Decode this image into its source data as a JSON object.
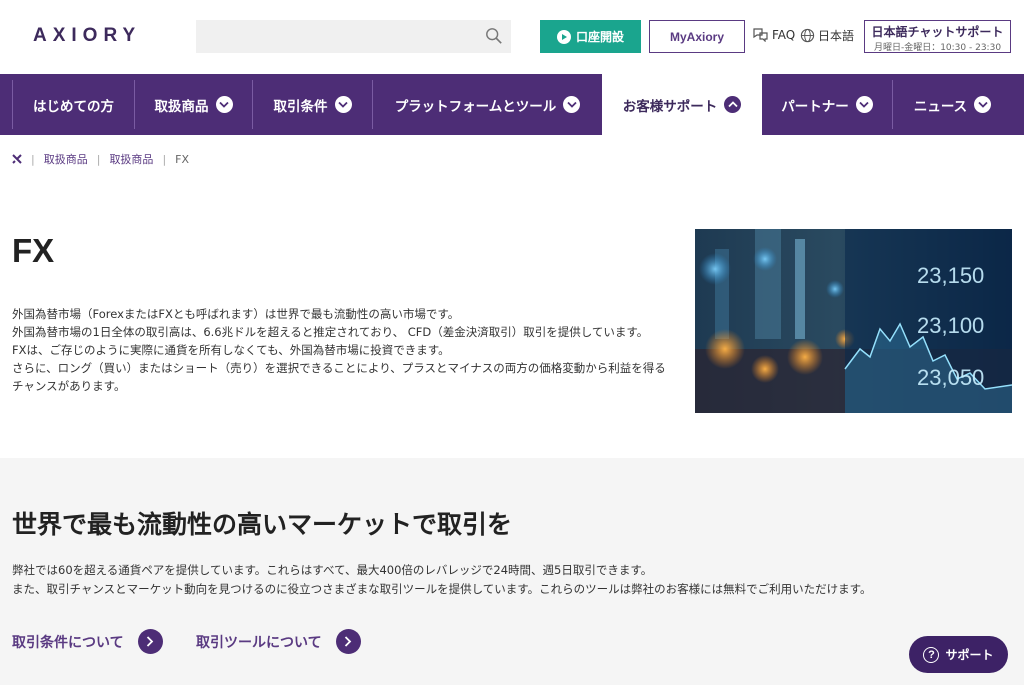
{
  "header": {
    "logo": "AXIORY",
    "search_placeholder": "",
    "open_account": "口座開設",
    "my_axiory": "MyAxiory",
    "faq": "FAQ",
    "language": "日本語",
    "chat_title": "日本語チャットサポート",
    "chat_hours": "月曜日-金曜日：10:30 - 23:30"
  },
  "nav": {
    "items": [
      {
        "label": "はじめての方",
        "chevron": false
      },
      {
        "label": "取扱商品",
        "chevron": true
      },
      {
        "label": "取引条件",
        "chevron": true
      },
      {
        "label": "プラットフォームとツール",
        "chevron": true
      },
      {
        "label": "お客様サポート",
        "chevron": true,
        "active": true
      },
      {
        "label": "パートナー",
        "chevron": true
      },
      {
        "label": "ニュース",
        "chevron": true
      }
    ]
  },
  "breadcrumb": [
    "取扱商品",
    "取扱商品",
    "FX"
  ],
  "intro": {
    "title": "FX",
    "lines": [
      "外国為替市場（ForexまたはFXとも呼ばれます）は世界で最も流動性の高い市場です。",
      "外国為替市場の1日全体の取引高は、6.6兆ドルを超えると推定されており、 CFD（差金決済取引）取引を提供しています。",
      "FXは、ご存じのように実際に通貨を所有しなくても、外国為替市場に投資できます。",
      "さらに、ロング（買い）またはショート（売り）を選択できることにより、プラスとマイナスの両方の価格変動から利益を得るチャンスがあります。"
    ],
    "hero_numbers": [
      "23,150",
      "23,100",
      "23,050"
    ]
  },
  "market": {
    "title": "世界で最も流動性の高いマーケットで取引を",
    "line1": "弊社では60を超える通貨ペアを提供しています。これらはすべて、最大400倍のレバレッジで24時間、週5日取引できます。",
    "line2": "また、取引チャンスとマーケット動向を見つけるのに役立つさまざまな取引ツールを提供しています。これらのツールは弊社のお客様には無料でご利用いただけます。",
    "link1": "取引条件について",
    "link2": "取引ツールについて"
  },
  "support_button": "サポート",
  "colors": {
    "primary": "#4d2d76",
    "accent": "#1aa58e",
    "dark": "#3d2266"
  }
}
